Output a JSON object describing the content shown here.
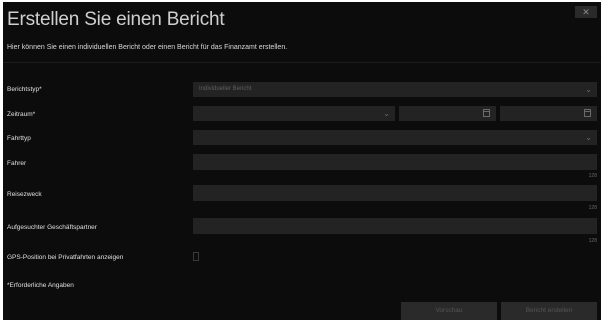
{
  "dialog": {
    "title": "Erstellen Sie einen Bericht",
    "close_label": "✕",
    "intro": "Hier können Sie einen individuellen Bericht oder einen Bericht für das Finanzamt erstellen.",
    "fields": {
      "report_type": {
        "label": "Berichtstyp*",
        "value": "Individueller Bericht"
      },
      "period": {
        "label": "Zeitraum*",
        "select_value": "",
        "from_value": "",
        "to_value": ""
      },
      "vehicle_type": {
        "label": "Fahrttyp",
        "value": ""
      },
      "driver": {
        "label": "Fahrer",
        "value": "",
        "counter": "128"
      },
      "purpose": {
        "label": "Reisezweck",
        "value": "",
        "counter": "128"
      },
      "partner": {
        "label": "Aufgesuchter Geschäftspartner",
        "value": "",
        "counter": "128"
      },
      "gps": {
        "label": "GPS-Position bei Privatfahrten anzeigen",
        "checked": false
      }
    },
    "required_note": "*Erforderliche Angaben",
    "buttons": {
      "preview": "Vorschau",
      "create": "Bericht erstellen"
    }
  }
}
